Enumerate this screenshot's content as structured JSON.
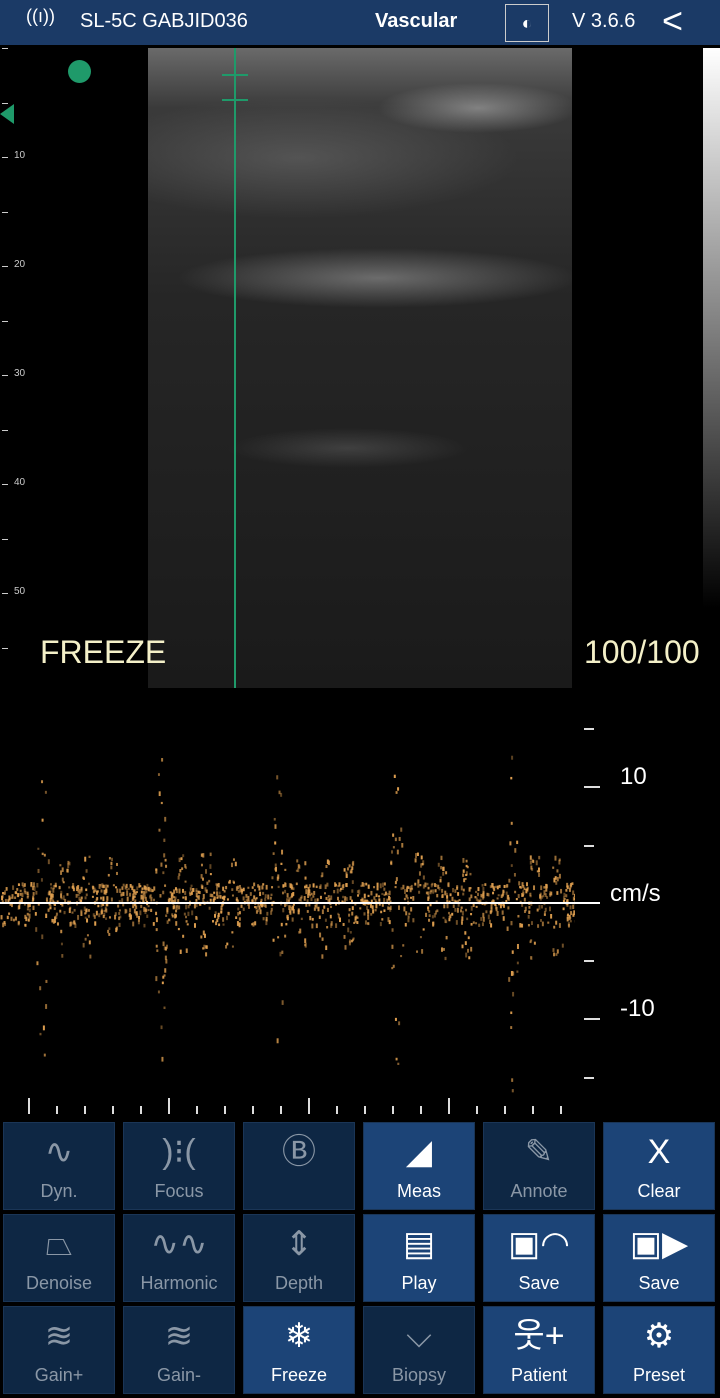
{
  "header": {
    "title": "SL-5C GABJID036",
    "preset": "Vascular",
    "version": "V 3.6.6",
    "icons": [
      "wifi-signal-icon",
      "probe-image-icon",
      "back-chevron-icon"
    ]
  },
  "image": {
    "status": "FREEZE",
    "frame": "100/100",
    "depth_labels": [
      "10",
      "20",
      "30",
      "40",
      "50"
    ]
  },
  "doppler": {
    "scale_labels": [
      "10",
      "cm/s",
      "-10"
    ],
    "trace_color": "#e0a050"
  },
  "buttons": [
    {
      "label": "Dyn.",
      "icon": "dynamic-range-icon",
      "active": false
    },
    {
      "label": "Focus",
      "icon": "focus-icon",
      "active": false
    },
    {
      "label": "",
      "icon": "b-mode-icon",
      "active": false
    },
    {
      "label": "Meas",
      "icon": "measure-ruler-icon",
      "active": true
    },
    {
      "label": "Annote",
      "icon": "annotate-icon",
      "active": false
    },
    {
      "label": "Clear",
      "icon": "clear-x-icon",
      "active": true
    },
    {
      "label": "Denoise",
      "icon": "denoise-icon",
      "active": false
    },
    {
      "label": "Harmonic",
      "icon": "harmonic-wave-icon",
      "active": false
    },
    {
      "label": "Depth",
      "icon": "depth-icon",
      "active": false
    },
    {
      "label": "Play",
      "icon": "film-play-icon",
      "active": true
    },
    {
      "label": "Save",
      "icon": "save-image-icon",
      "active": true
    },
    {
      "label": "Save",
      "icon": "save-video-icon",
      "active": true
    },
    {
      "label": "Gain+",
      "icon": "gain-up-icon",
      "active": false
    },
    {
      "label": "Gain-",
      "icon": "gain-down-icon",
      "active": false
    },
    {
      "label": "Freeze",
      "icon": "snowflake-icon",
      "active": true
    },
    {
      "label": "Biopsy",
      "icon": "biopsy-needle-icon",
      "active": false
    },
    {
      "label": "Patient",
      "icon": "patient-add-icon",
      "active": true
    },
    {
      "label": "Preset",
      "icon": "gear-icon",
      "active": true
    }
  ],
  "colors": {
    "header": "#1b3a66",
    "button_active": "#1c4477",
    "button_inactive": "#0e2744",
    "cursor": "#1f9a6a"
  }
}
